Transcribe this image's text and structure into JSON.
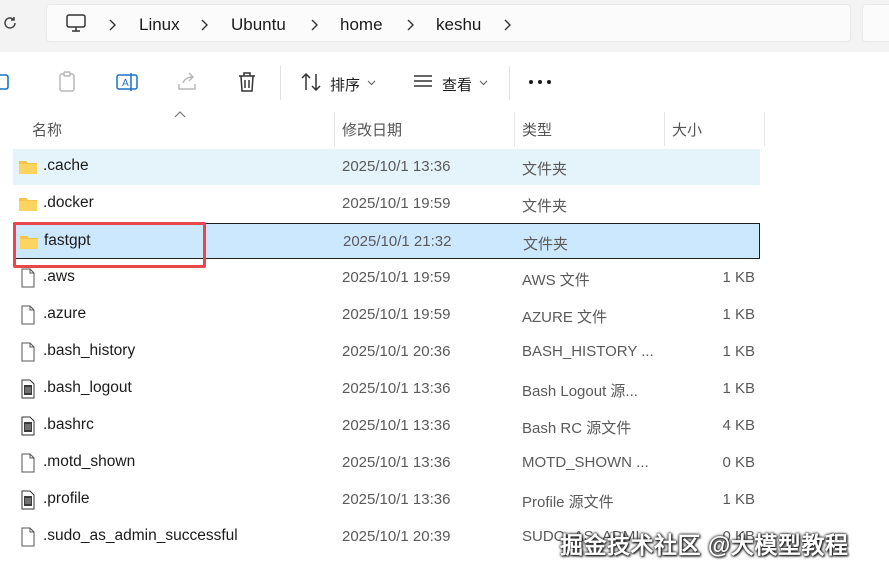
{
  "breadcrumb": [
    "Linux",
    "Ubuntu",
    "home",
    "keshu"
  ],
  "toolbar": {
    "sort_label": "排序",
    "view_label": "查看"
  },
  "columns": {
    "name": "名称",
    "modified": "修改日期",
    "type": "类型",
    "size": "大小"
  },
  "files": [
    {
      "icon": "folder-icon",
      "name": ".cache",
      "modified": "2025/10/1 13:36",
      "type": "文件夹",
      "size": "",
      "state": "hover"
    },
    {
      "icon": "folder-icon",
      "name": ".docker",
      "modified": "2025/10/1 19:59",
      "type": "文件夹",
      "size": "",
      "state": ""
    },
    {
      "icon": "folder-icon",
      "name": "fastgpt",
      "modified": "2025/10/1 21:32",
      "type": "文件夹",
      "size": "",
      "state": "selected"
    },
    {
      "icon": "file-icon",
      "name": ".aws",
      "modified": "2025/10/1 19:59",
      "type": "AWS 文件",
      "size": "1 KB",
      "state": ""
    },
    {
      "icon": "file-icon",
      "name": ".azure",
      "modified": "2025/10/1 19:59",
      "type": "AZURE 文件",
      "size": "1 KB",
      "state": ""
    },
    {
      "icon": "file-icon",
      "name": ".bash_history",
      "modified": "2025/10/1 20:36",
      "type": "BASH_HISTORY ...",
      "size": "1 KB",
      "state": ""
    },
    {
      "icon": "text-file-icon",
      "name": ".bash_logout",
      "modified": "2025/10/1 13:36",
      "type": "Bash Logout 源...",
      "size": "1 KB",
      "state": ""
    },
    {
      "icon": "text-file-icon",
      "name": ".bashrc",
      "modified": "2025/10/1 13:36",
      "type": "Bash RC 源文件",
      "size": "4 KB",
      "state": ""
    },
    {
      "icon": "file-icon",
      "name": ".motd_shown",
      "modified": "2025/10/1 13:36",
      "type": "MOTD_SHOWN ...",
      "size": "0 KB",
      "state": ""
    },
    {
      "icon": "text-file-icon",
      "name": ".profile",
      "modified": "2025/10/1 13:36",
      "type": "Profile 源文件",
      "size": "1 KB",
      "state": ""
    },
    {
      "icon": "file-icon",
      "name": ".sudo_as_admin_successful",
      "modified": "2025/10/1 20:39",
      "type": "SUDO_AS_ADMI...",
      "size": "0 KB",
      "state": ""
    }
  ],
  "watermark": "掘金技术社区 @大模型教程",
  "colors": {
    "selected_bg": "#cce8ff",
    "hover_bg": "#e5f3fb",
    "folder": "#f8c34a",
    "highlight_box": "#e8474c"
  }
}
